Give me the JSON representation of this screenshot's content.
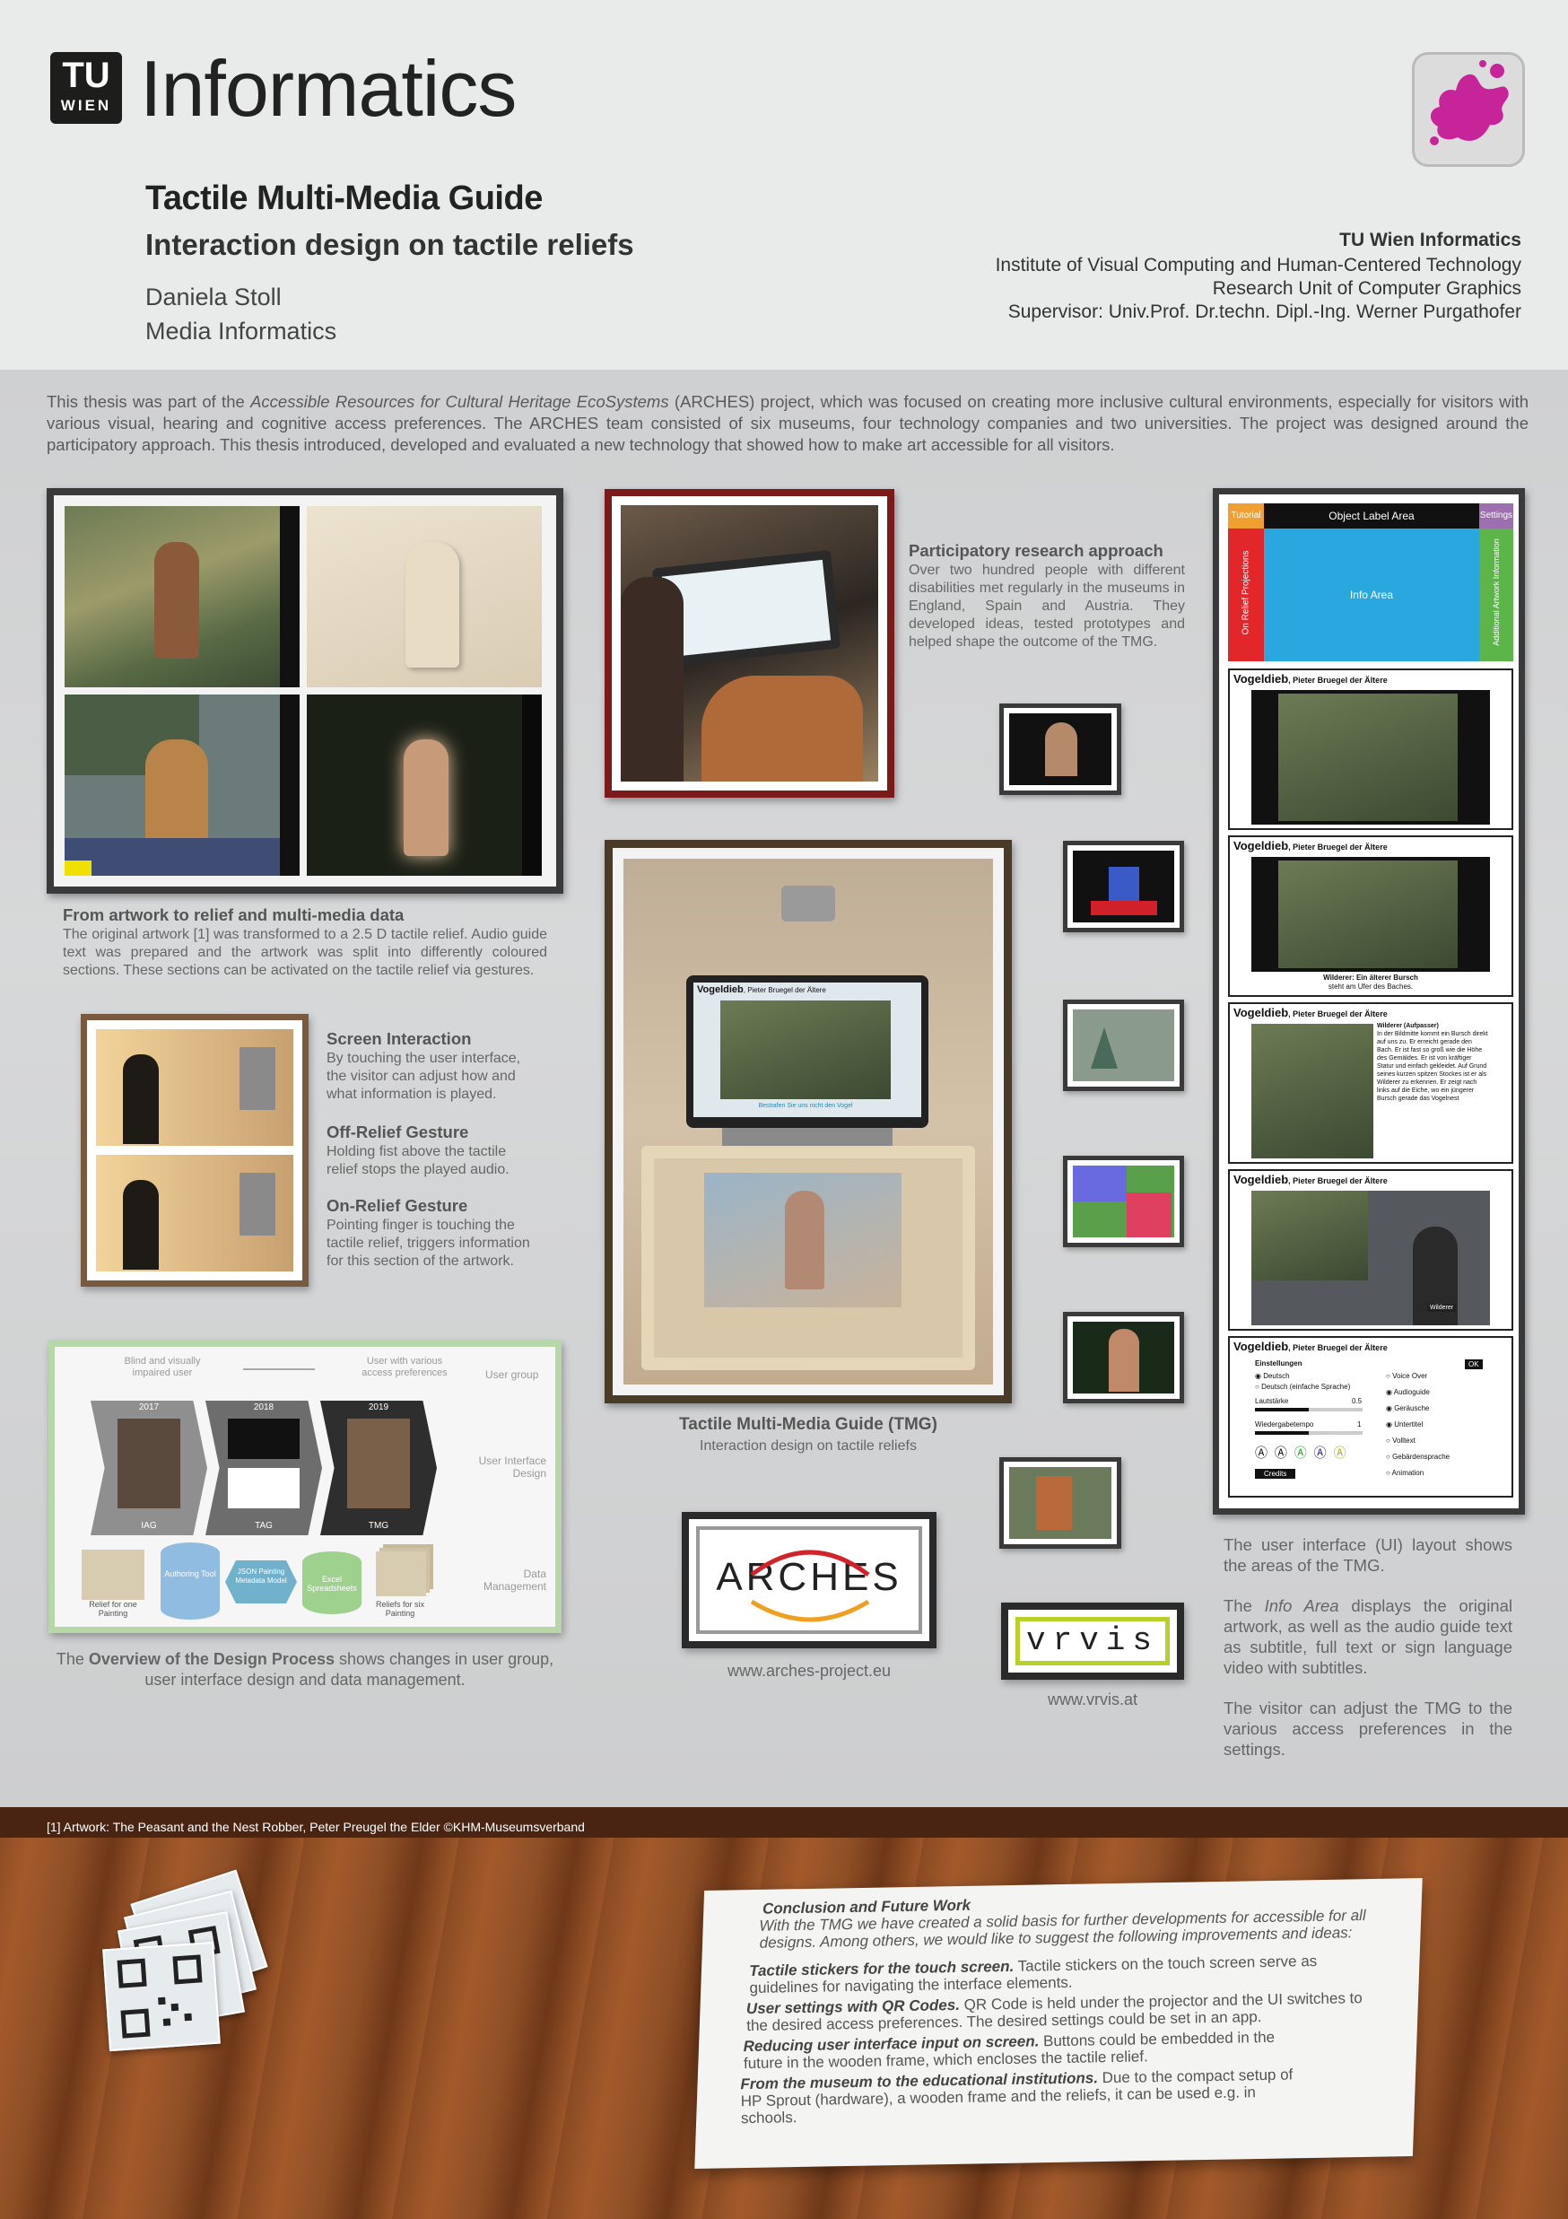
{
  "header": {
    "logo_top": "TU",
    "logo_bottom": "WIEN",
    "brand": "Informatics",
    "title": "Tactile Multi-Media Guide",
    "subtitle": "Interaction design on tactile reliefs",
    "author": "Daniela Stoll",
    "program": "Media Informatics",
    "institution": [
      "TU Wien Informatics",
      "Institute of Visual Computing and Human-Centered Technology",
      "Research Unit of Computer Graphics",
      "Supervisor: Univ.Prof. Dr.techn. Dipl.-Ing. Werner Purgathofer"
    ]
  },
  "intro": {
    "before": "This thesis was part of the ",
    "emph": "Accessible Resources for Cultural Heritage EcoSystems",
    "after": " (ARCHES) project, which was focused on creating more inclusive cultural environments, especially for visitors with various visual, hearing and cognitive access preferences. The ARCHES team consisted of six museums, four technology companies and two universities. The project was designed around the participatory approach. This thesis introduced, developed and evaluated a new technology that showed how to make art accessible for all visitors."
  },
  "artwork": {
    "heading": "From artwork to relief and multi-media data",
    "text": "The original artwork [1] was transformed to a 2.5 D tactile relief. Audio guide text was prepared and the artwork was split into differently coloured sections. These sections can be activated on the tactile relief via gestures."
  },
  "participatory": {
    "heading": "Participatory research approach",
    "text": "Over two hundred people with different disabilities met regularly in the museums in England, Spain and Austria. They developed ideas, tested prototypes and helped shape the outcome of the TMG."
  },
  "gestures": [
    {
      "heading": "Screen Interaction",
      "text": "By touching the user interface, the visitor can adjust how and what information is played."
    },
    {
      "heading": "Off-Relief Gesture",
      "text": "Holding fist above the tactile relief stops the played audio."
    },
    {
      "heading": "On-Relief Gesture",
      "text": "Pointing finger is touching the tactile relief, triggers information for this section of the artwork."
    }
  ],
  "design_process": {
    "top_left": "Blind and visually impaired user",
    "top_right": "User with various access preferences",
    "row_user_group": "User group",
    "row_ui": "User Interface Design",
    "row_data": "Data Management",
    "years": [
      "2017",
      "2018",
      "2019"
    ],
    "labels": [
      "IAG",
      "TAG",
      "TMG"
    ],
    "data_items": [
      "Relief for one Painting",
      "Authoring Tool",
      "JSON Painting Metadata Model",
      "Excel Spreadsheets",
      "Reliefs for six Painting"
    ],
    "caption_pre": "The ",
    "caption_bold": "Overview of the Design Process",
    "caption_post": " shows changes in user group, user interface design and data management."
  },
  "tmg": {
    "screen_title": "Vogeldieb",
    "screen_artist": ", Pieter Bruegel der Ältere",
    "screen_subtitle": "Bestrafen Sie uns nicht den Vogel",
    "caption_title": "Tactile Multi-Media Guide (TMG)",
    "caption_sub": "Interaction  design on tactile reliefs"
  },
  "logos": {
    "arches": "ARCHES",
    "arches_url": "www.arches-project.eu",
    "vrvis": "vrvis",
    "vrvis_url": "www.vrvis.at"
  },
  "ui_layout": {
    "tutorial": "Tutorial",
    "object_label": "Object Label Area",
    "settings": "Settings",
    "on_relief": "On Relief Projections",
    "info_area": "Info Area",
    "additional": "Additional Artwork Information",
    "panel_title": "Vogeldieb",
    "panel_artist": ", Pieter Bruegel der Ältere",
    "subtitle_line1": "Wilderer: Ein älterer Bursch",
    "subtitle_line2": "steht am Ufer des Baches.",
    "fulltext_title": "Wilderer (Aufpasser)",
    "fulltext": "In der Bildmitte kommt ein Bursch direkt auf uns zu. Er erreicht gerade den Bach. Er ist fast so groß wie die Höhe des Gemäldes. Er ist von kräftiger Statur und einfach gekleidet. Auf Grund seines kurzen spitzen Stockes ist er als Wilderer zu erkennen. Er zeigt nach links auf die Eiche, wo ein jüngerer Bursch gerade das Vogelnest",
    "sign_caption": "Wilderer",
    "settings_title": "Einstellungen",
    "ok": "OK",
    "lang_1": "Deutsch",
    "lang_2": "Deutsch (einfache Sprache)",
    "volume": "Lautstärke",
    "volume_val": "0.5",
    "speed": "Wiedergabetempo",
    "speed_val": "1",
    "opt_voiceover": "Voice Over",
    "opt_audioguide": "Audioguide",
    "opt_sounds": "Geräusche",
    "opt_subtitle": "Untertitel",
    "opt_fulltext": "Volltext",
    "opt_sign": "Gebärdensprache",
    "opt_animation": "Animation",
    "credits": "Credits",
    "desc1": "The user interface (UI) layout shows the areas of the TMG.",
    "desc2_pre": "The ",
    "desc2_emph": "Info Area",
    "desc2_post": " displays the original artwork, as well as the audio guide text as subtitle, full text or sign language video with subtitles.",
    "desc3": "The visitor can adjust the TMG to the various access preferences in the settings."
  },
  "footnote": "[1] Artwork: The Peasant and the Nest Robber, Peter Preugel the Elder  ©KHM-Museumsverband",
  "conclusion": {
    "title": "Conclusion and Future Work",
    "intro": "With the TMG we have created a solid basis for further developments for accessible for all designs. Among others, we would like to suggest the following improvements and ideas:",
    "items": [
      {
        "bold": "Tactile stickers for the touch screen.",
        "text": " Tactile stickers on the touch screen serve as guidelines for navigating the interface elements."
      },
      {
        "bold": "User settings with QR Codes.",
        "text": " QR Code is held under the projector and the UI switches to the desired access preferences. The desired settings could be set in an app."
      },
      {
        "bold": "Reducing user interface input on screen.",
        "text": " Buttons could be embedded in the future in the wooden frame, which encloses the tactile relief."
      },
      {
        "bold": "From the museum to the educational institutions.",
        "text": " Due to the compact setup of HP Sprout (hardware), a wooden frame and the reliefs, it can be used e.g. in schools."
      }
    ]
  },
  "colors": {
    "tutorial": "#f0a030",
    "object_label": "#111111",
    "settings": "#9b6fb0",
    "on_relief": "#e3262a",
    "info_area": "#29a8e0",
    "additional": "#5bb548",
    "splat": "#c8249a"
  }
}
